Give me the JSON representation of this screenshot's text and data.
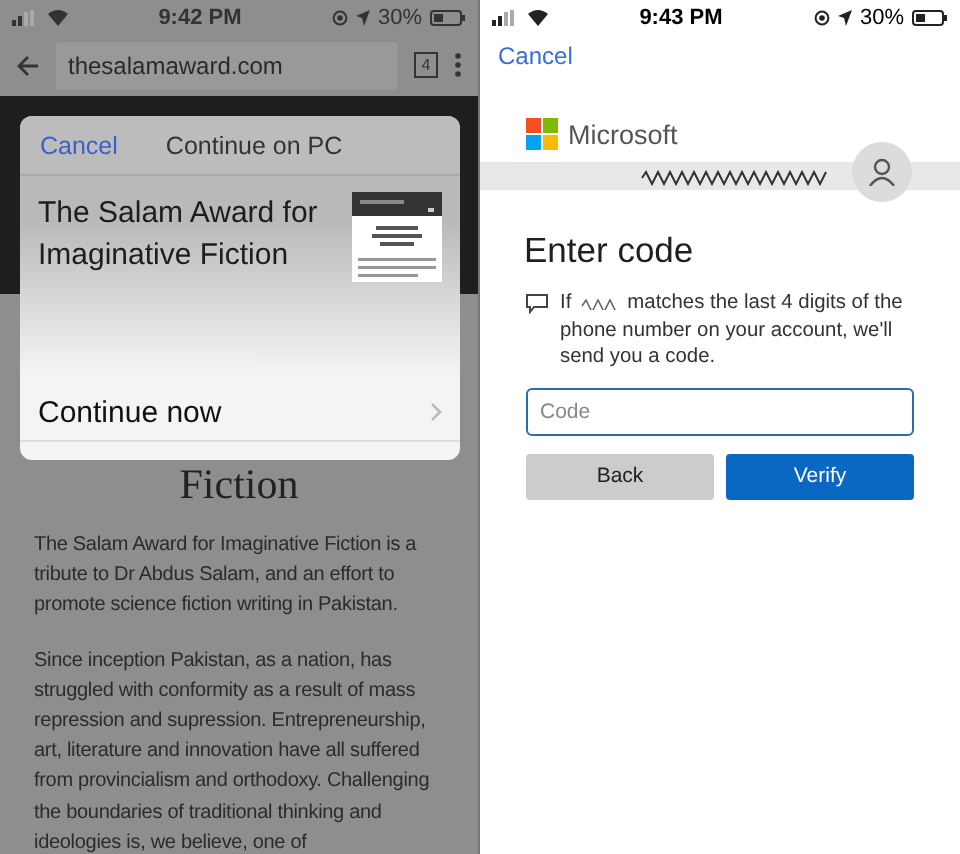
{
  "left_screen": {
    "status_bar": {
      "time": "9:42 PM",
      "battery": "30%"
    },
    "address_bar": {
      "url": "thesalamaward.com",
      "tab_count": "4"
    },
    "page": {
      "heading": "Fiction",
      "paragraphs": [
        "The Salam Award for Imaginative Fiction is a tribute to Dr Abdus Salam, and an effort to promote science fiction writing in Pakistan.",
        "Since inception Pakistan, as a nation, has struggled with conformity as a result of mass repression and supression. Entrepreneurship, art, literature and innovation have all suffered from provincialism and orthodoxy. Challenging the boundaries of traditional thinking and ideologies is, we believe, one of"
      ]
    },
    "sheet": {
      "cancel": "Cancel",
      "title": "Continue on PC",
      "page_title": "The Salam Award for Imaginative Fiction",
      "action": "Continue now"
    }
  },
  "right_screen": {
    "status_bar": {
      "time": "9:43 PM",
      "battery": "30%"
    },
    "cancel": "Cancel",
    "brand": "Microsoft",
    "heading": "Enter code",
    "message_start": "If",
    "message_middle": "matches the last 4 digits of the",
    "message_end": "phone number on your account, we'll send you a code.",
    "code_field": {
      "placeholder": "Code"
    },
    "buttons": [
      {
        "label": "Back",
        "kind": "secondary"
      },
      {
        "label": "Verify",
        "kind": "primary"
      }
    ]
  }
}
